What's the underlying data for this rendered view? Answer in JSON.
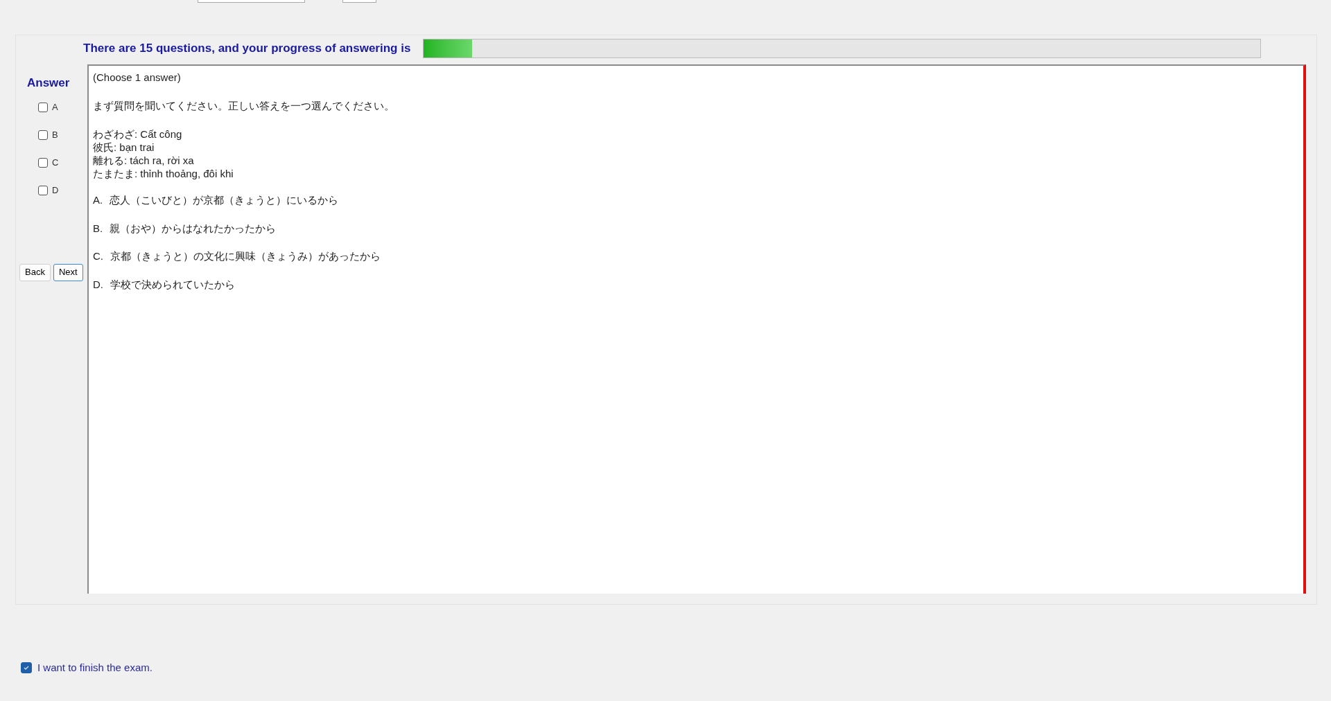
{
  "progress": {
    "label": "There are 15 questions, and your progress of answering is",
    "level": 0.058
  },
  "answer": {
    "title": "Answer",
    "options": [
      {
        "label": "A",
        "checked": false
      },
      {
        "label": "B",
        "checked": false
      },
      {
        "label": "C",
        "checked": false
      },
      {
        "label": "D",
        "checked": false
      }
    ]
  },
  "navigation": {
    "buttons": [
      {
        "label": "Back",
        "selected": false
      },
      {
        "label": "Next",
        "selected": true
      }
    ]
  },
  "question": {
    "instruction": "(Choose 1 answer)",
    "prompt": "まず質問を聞いてください。正しい答えを一つ選んでください。",
    "vocabulary": [
      "わざわざ: Cất công",
      "彼氏: bạn trai",
      "離れる: tách ra, rời xa",
      "たまたま: thỉnh thoảng, đôi khi"
    ],
    "choices": [
      {
        "letter": "A.",
        "text": "恋人（こいびと）が京都（きょうと）にいるから"
      },
      {
        "letter": "B.",
        "text": "親（おや）からはなれたかったから"
      },
      {
        "letter": "C.",
        "text": "京都（きょうと）の文化に興味（きょうみ）があったから"
      },
      {
        "letter": "D.",
        "text": "学校で決められていたから"
      }
    ]
  },
  "finish": {
    "label": "I want to finish the exam.",
    "checked": true
  }
}
